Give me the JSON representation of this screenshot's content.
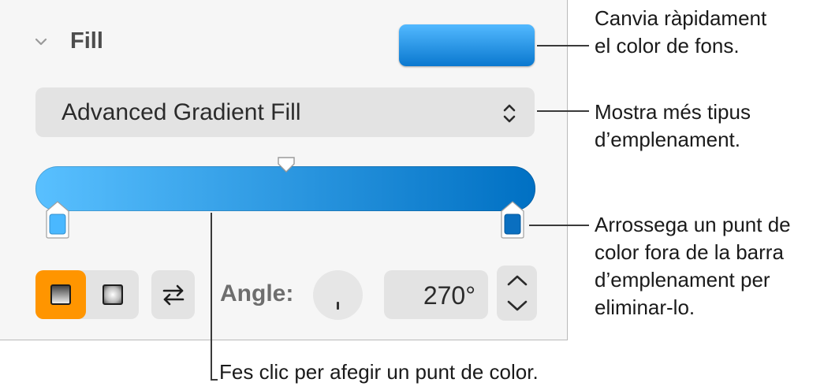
{
  "panel": {
    "section_title": "Fill",
    "fill_type_value": "Advanced Gradient Fill",
    "angle_label": "Angle:",
    "angle_value": "270°",
    "gradient": {
      "start_color": "#59c0ff",
      "end_color": "#0070c3",
      "stop_colors": [
        "#4ab8ff",
        "#0a6fc0"
      ]
    },
    "color_well_color": "#1b8ae0",
    "active_segment_color": "#ff9500"
  },
  "callouts": {
    "color_well": [
      "Canvia ràpidament",
      "el color de fons."
    ],
    "fill_type": [
      "Mostra més tipus",
      "d’emplenament."
    ],
    "remove_stop": [
      "Arrossega un punt de",
      "color fora de la barra",
      "d’emplenament per",
      "eliminar-lo."
    ],
    "add_stop": [
      "Fes clic per afegir un punt de color."
    ]
  },
  "icons": [
    "chevron-down-icon",
    "up-down-arrows-icon",
    "linear-gradient-icon",
    "radial-gradient-icon",
    "swap-arrows-icon",
    "stepper-up-icon",
    "stepper-down-icon"
  ]
}
